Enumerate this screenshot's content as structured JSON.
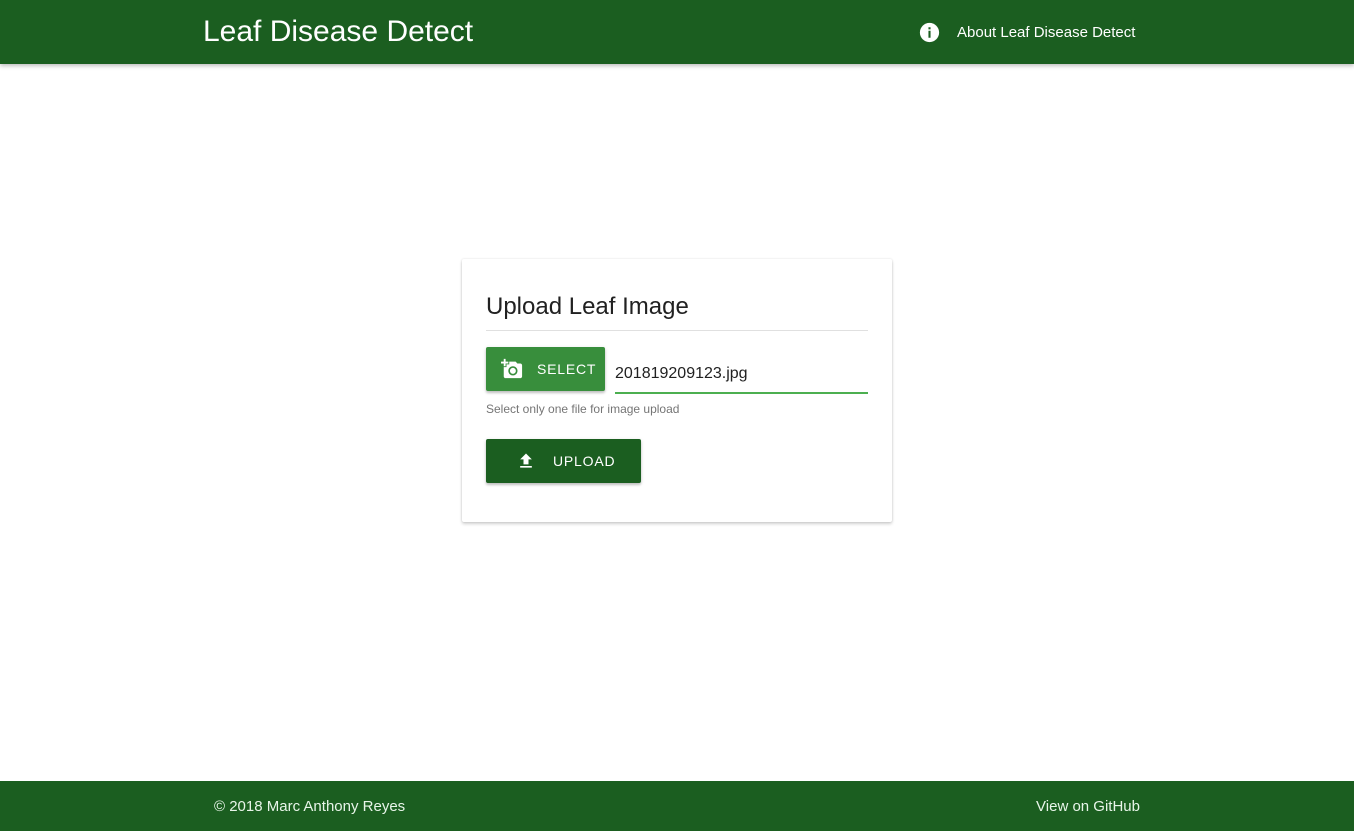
{
  "header": {
    "title": "Leaf Disease Detect",
    "about_link": "About Leaf Disease Detect",
    "about_icon": "info-icon"
  },
  "upload_card": {
    "title": "Upload Leaf Image",
    "select_button": {
      "label": "SELECT",
      "icon": "add-a-photo-icon"
    },
    "file_field": {
      "value": "201819209123.jpg"
    },
    "helper_text": "Select only one file for image upload",
    "upload_button": {
      "label": "UPLOAD",
      "icon": "upload-icon"
    }
  },
  "footer": {
    "copyright": "© 2018 Marc Anthony Reyes",
    "github_link": "View on GitHub"
  },
  "colors": {
    "primary_dark": "#1b5e20",
    "primary": "#388e3c",
    "accent_line": "#4caf50"
  }
}
